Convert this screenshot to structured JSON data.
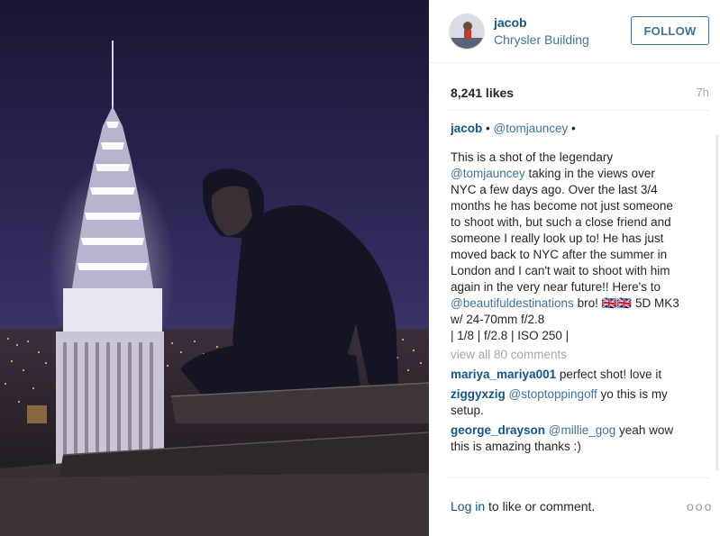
{
  "post": {
    "username": "jacob",
    "location": "Chrysler Building",
    "follow_label": "FOLLOW",
    "likes": "8,241 likes",
    "time": "7h"
  },
  "caption": {
    "username": "jacob",
    "sep1": " • ",
    "tag": "@tomjauncey",
    "sep2": " •",
    "lines": [
      "This is a shot of the legendary",
      "taking in the views over",
      "NYC a few days ago. Over the last 3/4",
      "months he has become not just someone",
      "to shoot with, but such a close friend and",
      "someone I really look up to! He has just",
      "moved back to NYC after the summer in",
      "London and I can't wait to shoot with him",
      "again in the very near future!! Here's to",
      "bro! 🇬🇧🇬🇧 5D MK3",
      "w/ 24-70mm f/2.8",
      "| 1/8 | f/2.8 | ISO 250 |"
    ],
    "mention_inline": "@tomjauncey",
    "mention_beautiful": "@beautifuldestinations"
  },
  "view_all": "view all 80 comments",
  "comments": [
    {
      "user": "mariya_mariya001",
      "text": " perfect shot! love it"
    },
    {
      "user": "ziggyxzig",
      "mention": " @stoptoppingoff",
      "text1": " yo this is my",
      "text2": "setup."
    },
    {
      "user": "george_drayson",
      "mention": " @millie_gog",
      "text1": " yeah wow",
      "text2": "this is amazing thanks :)"
    }
  ],
  "footer": {
    "login": "Log in",
    "rest": " to like or comment.",
    "more": "ooo"
  },
  "colors": {
    "link": "#125688",
    "mention": "#3f729b",
    "muted": "#a5a7aa",
    "night_sky": "#2b2650"
  },
  "icons": {
    "more": "more-options-icon"
  }
}
